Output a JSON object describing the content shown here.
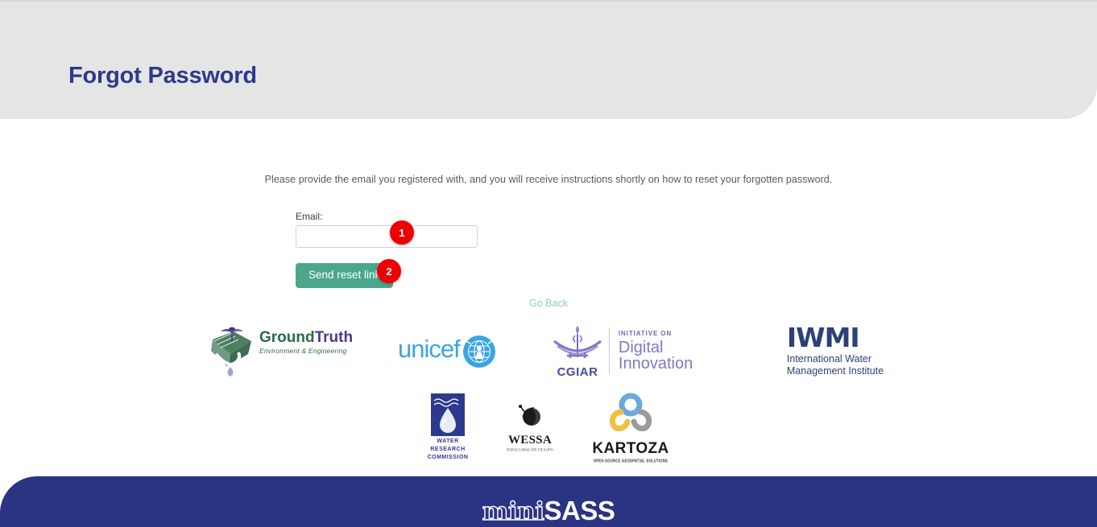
{
  "page": {
    "title": "Forgot Password",
    "title_color": "#2d3a8c",
    "header_bg": "#e5e5e5"
  },
  "main": {
    "instruction": "Please provide the email you registered with, and you will receive instructions shortly on how to reset your forgotten password.",
    "form": {
      "email_label": "Email:",
      "email_value": "",
      "email_placeholder": "",
      "submit_label": "Send reset link",
      "submit_color": "#4ba68c"
    },
    "go_back_label": "Go Back",
    "go_back_color": "#8ecfc0"
  },
  "annotations": [
    {
      "number": "1",
      "target": "email-input",
      "color": "#ee0000"
    },
    {
      "number": "2",
      "target": "send-reset-link-button",
      "color": "#ee0000"
    }
  ],
  "logos": {
    "row1": [
      {
        "name": "groundtruth",
        "word_primary": "Ground",
        "word_secondary": "Truth",
        "tagline": "Environment & Engineering",
        "color_primary": "#2b6a45",
        "color_secondary": "#4a3a8c"
      },
      {
        "name": "unicef",
        "wordmark": "unicef",
        "color": "#3aa5e0"
      },
      {
        "name": "cgiar",
        "wordmark": "CGIAR",
        "initiative_label": "INITIATIVE ON",
        "initiative_name": "Digital Innovation",
        "color": "#7a7ac6"
      },
      {
        "name": "iwmi",
        "wordmark": "IWMI",
        "sub_line1": "International Water",
        "sub_line2": "Management Institute",
        "color": "#2d4178"
      }
    ],
    "row2": [
      {
        "name": "water-research-commission",
        "line1": "WATER",
        "line2": "RESEARCH",
        "line3": "COMMISSION",
        "color": "#2b3a8f"
      },
      {
        "name": "wessa",
        "wordmark": "WESSA",
        "tagline": "PEOPLE CARING FOR THE EARTH",
        "color": "#1a1a1a"
      },
      {
        "name": "kartoza",
        "wordmark": "KARTOZA",
        "tagline": "OPEN SOURCE GEOSPATIAL SOLUTIONS",
        "color": "#1a1a1a"
      }
    ]
  },
  "footer": {
    "logo_prefix": "mini",
    "logo_suffix": "SASS",
    "bg_color": "#2b3482"
  }
}
